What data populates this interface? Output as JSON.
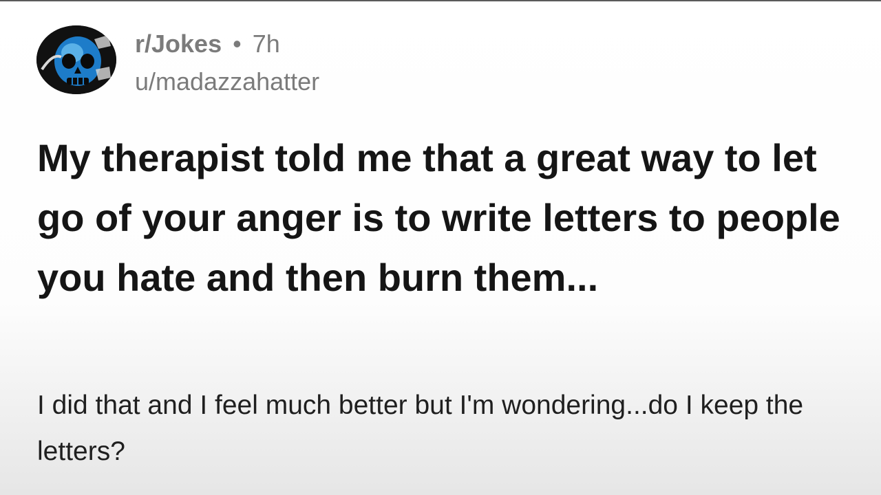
{
  "post": {
    "subreddit": "r/Jokes",
    "separator": "•",
    "age": "7h",
    "author": "u/madazzahatter",
    "title": "My therapist told me that a great way to let go of your anger is to write letters to people you hate and then burn them...",
    "body": "I did that and I feel much better but I'm wondering...do I keep the letters?"
  },
  "avatar": {
    "icon": "subreddit-avatar-icon",
    "colors": {
      "background": "#111111",
      "skull": "#1d7cc9",
      "skull_highlight": "#6fc3f2"
    }
  },
  "theme": {
    "meta_text": "#7b7b7b",
    "title_text": "#151515",
    "body_text": "#1f1f1f"
  }
}
